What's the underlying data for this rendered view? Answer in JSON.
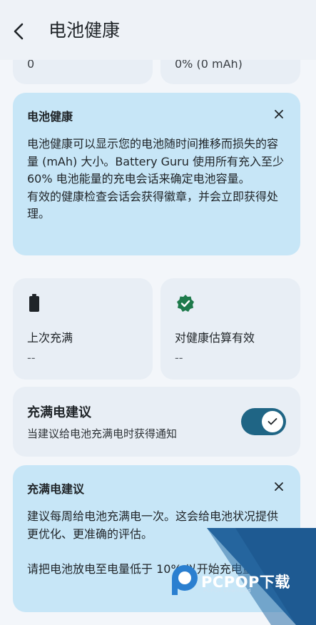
{
  "header": {
    "title": "电池健康",
    "back_icon": "chevron-left-icon"
  },
  "top_cards": [
    {
      "value": "0"
    },
    {
      "value": "0% (0 mAh)"
    }
  ],
  "battery_health_info": {
    "title": "电池健康",
    "body": [
      "电池健康可以显示您的电池随时间推移而损失的容量 (mAh) 大小。Battery Guru 使用所有充入至少 60% 电池能量的充电会话来确定电池容量。",
      "有效的健康检查会话会获得徽章，并会立即获得处理。"
    ]
  },
  "stats": [
    {
      "icon": "battery-full-icon",
      "label": "上次充满",
      "value": "--"
    },
    {
      "icon": "verified-badge-icon",
      "label": "对健康估算有效",
      "value": "--"
    }
  ],
  "full_charge_setting": {
    "title": "充满电建议",
    "subtitle": "当建议给电池充满电时获得通知",
    "enabled": true
  },
  "full_charge_info": {
    "title": "充满电建议",
    "body": [
      "建议每周给电池充满电一次。这会给电池状况提供更优化、更准确的评估。",
      "",
      "请把电池放电至电量低于 10% 以开始充电量。"
    ]
  },
  "watermark": {
    "text": "PCPOP下载",
    "sub": "PCPOP Download"
  },
  "colors": {
    "background": "#f3f6fa",
    "card": "#e8eef5",
    "info_card": "#c7e6f7",
    "accent": "#1f6585",
    "badge_green": "#1e7a4b"
  }
}
